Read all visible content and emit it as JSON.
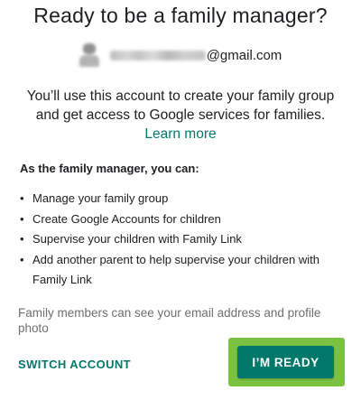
{
  "title": "Ready to be a family manager?",
  "account": {
    "email_visible": "@gmail.com",
    "avatar_icon": "account-avatar-icon"
  },
  "description": {
    "line1": "You’ll use this account to create your family group",
    "line2": "and get access to Google services for families.",
    "learn_more": "Learn more"
  },
  "capabilities": {
    "heading": "As the family manager, you can:",
    "items": [
      "Manage your family group",
      "Create Google Accounts for children",
      "Supervise your children with Family Link",
      "Add another parent to help supervise your children with Family Link"
    ]
  },
  "note": "Family members can see your email address and profile photo",
  "actions": {
    "switch_account": "SWITCH ACCOUNT",
    "ready": "I’M READY"
  },
  "colors": {
    "accent": "#00796b",
    "highlight": "#7cc242",
    "text": "#202124",
    "muted": "#6f6f6f"
  }
}
